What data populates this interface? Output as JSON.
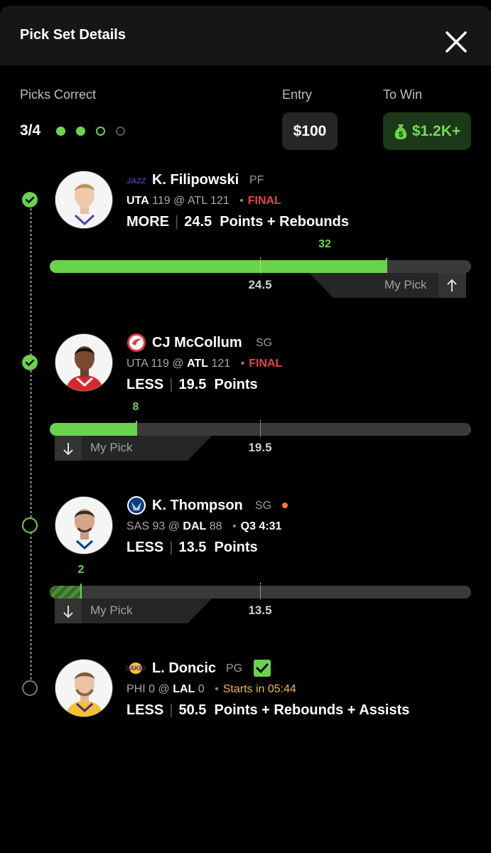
{
  "header": {
    "title": "Pick Set Details",
    "close_icon": "close-icon"
  },
  "summary": {
    "picks_correct_label": "Picks Correct",
    "picks_correct_value": "3/4",
    "dots": [
      "correct",
      "correct",
      "live",
      "pending"
    ],
    "entry_label": "Entry",
    "entry_value": "$100",
    "to_win_label": "To Win",
    "to_win_value": "$1.2K+",
    "to_win_icon": "money-bag-icon"
  },
  "colors": {
    "accent_green": "#6ad34d",
    "final_red": "#e2464a",
    "starts_yellow": "#f2b635",
    "live_orange": "#f07c2a"
  },
  "picks": [
    {
      "name": "K. Filipowski",
      "position": "PF",
      "team_logo": "jazz-logo-icon",
      "game": {
        "away": "UTA",
        "away_score": "119",
        "at": "@",
        "home": "ATL",
        "home_score": "121",
        "status": "FINAL",
        "player_team": "away"
      },
      "direction": "MORE",
      "line": "24.5",
      "stat": "Points + Rebounds",
      "result": "correct",
      "current_value": "32",
      "progress_value": 32,
      "progress_max": 40,
      "my_pick_label": "My Pick",
      "pick_icon": "arrow-up-icon"
    },
    {
      "name": "CJ McCollum",
      "position": "SG",
      "team_logo": "hawks-logo-icon",
      "game": {
        "away": "UTA",
        "away_score": "119",
        "at": "@",
        "home": "ATL",
        "home_score": "121",
        "status": "FINAL",
        "player_team": "home"
      },
      "direction": "LESS",
      "line": "19.5",
      "stat": "Points",
      "result": "correct",
      "current_value": "8",
      "progress_value": 8,
      "progress_max": 39,
      "my_pick_label": "My Pick",
      "pick_icon": "arrow-down-icon"
    },
    {
      "name": "K. Thompson",
      "position": "SG",
      "team_logo": "mavericks-logo-icon",
      "game": {
        "away": "SAS",
        "away_score": "93",
        "at": "@",
        "home": "DAL",
        "home_score": "88",
        "status": "Q3 4:31",
        "player_team": "home"
      },
      "direction": "LESS",
      "line": "13.5",
      "stat": "Points",
      "result": "live",
      "current_value": "2",
      "progress_value": 2,
      "progress_max": 27,
      "my_pick_label": "My Pick",
      "pick_icon": "arrow-down-icon"
    },
    {
      "name": "L. Doncic",
      "position": "PG",
      "team_logo": "lakers-logo-icon",
      "game": {
        "away": "PHI",
        "away_score": "0",
        "at": "@",
        "home": "LAL",
        "home_score": "0",
        "status": "Starts in 05:44",
        "player_team": "home"
      },
      "direction": "LESS",
      "line": "50.5",
      "stat": "Points + Rebounds + Assists",
      "result": "pending",
      "badge_icon": "checkbox-checked-icon"
    }
  ]
}
